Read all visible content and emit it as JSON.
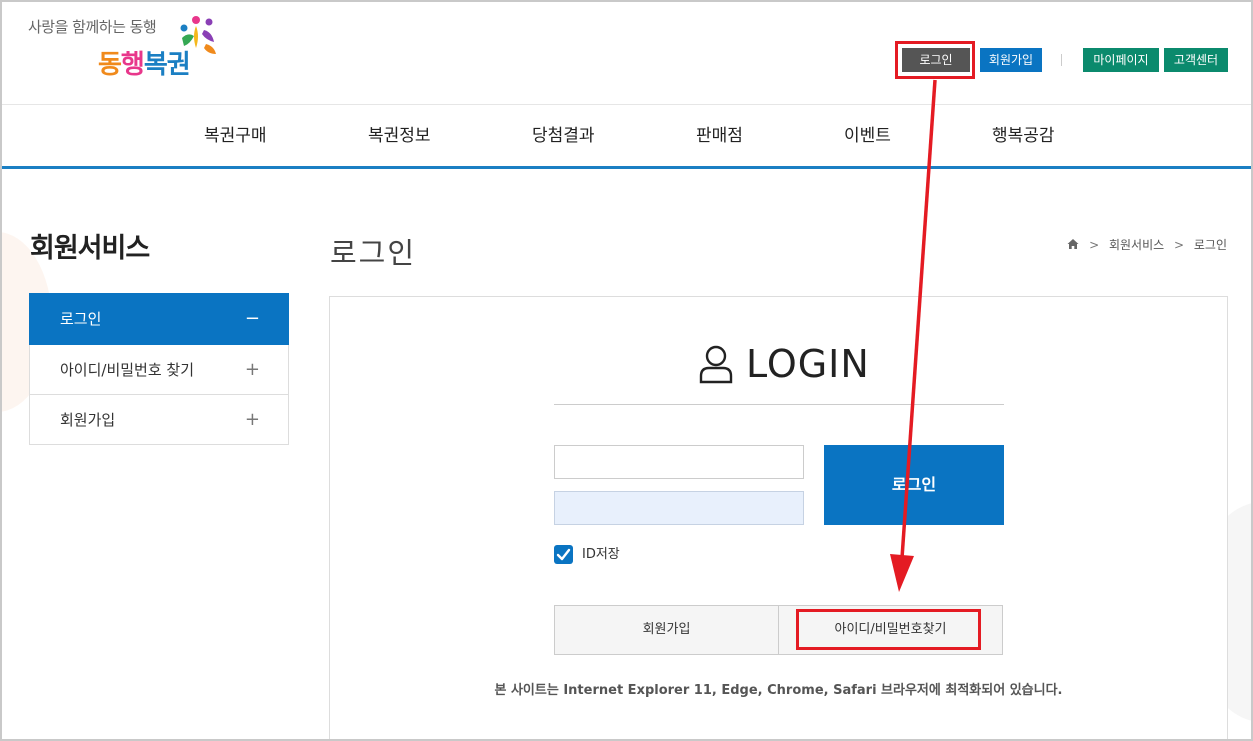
{
  "header": {
    "logo_tagline": "사랑을 함께하는 동행",
    "logo_brand_1": "동",
    "logo_brand_2": "행",
    "logo_brand_3": "복권",
    "top_buttons": {
      "login": "로그인",
      "join": "회원가입",
      "mypage": "마이페이지",
      "support": "고객센터"
    }
  },
  "gnb": {
    "items": [
      "복권구매",
      "복권정보",
      "당첨결과",
      "판매점",
      "이벤트",
      "행복공감"
    ]
  },
  "sidebar": {
    "title": "회원서비스",
    "items": [
      {
        "label": "로그인",
        "sign": "−"
      },
      {
        "label": "아이디/비밀번호 찾기",
        "sign": "+"
      },
      {
        "label": "회원가입",
        "sign": "+"
      }
    ]
  },
  "content": {
    "page_title": "로그인",
    "breadcrumb": [
      "회원서비스",
      "로그인"
    ],
    "breadcrumb_sep": ">"
  },
  "login_form": {
    "heading": "LOGIN",
    "id_value": "",
    "pw_value": "",
    "submit_label": "로그인",
    "save_id_label": "ID저장",
    "save_id_checked": true,
    "join_label": "회원가입",
    "find_label": "아이디/비밀번호찾기",
    "notice": "본 사이트는 Internet Explorer 11, Edge, Chrome, Safari 브라우저에 최적화되어 있습니다."
  },
  "colors": {
    "brand_blue": "#0a74c2",
    "green": "#0b8a6d",
    "annotation_red": "#e41b23"
  }
}
